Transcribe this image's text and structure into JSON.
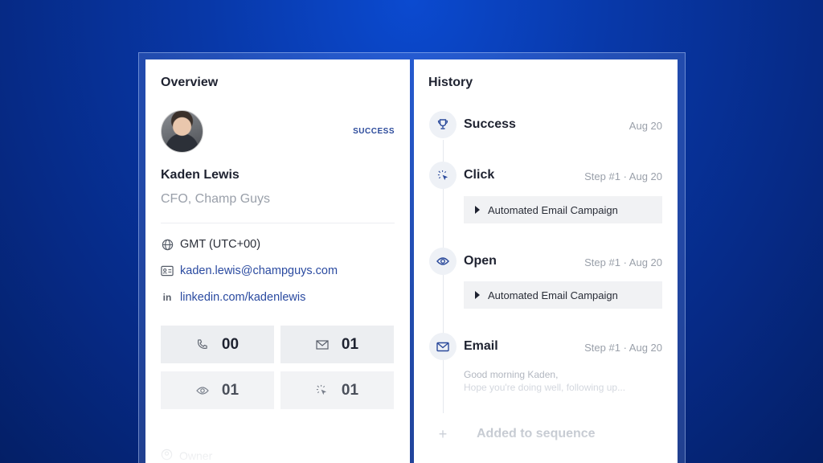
{
  "overview": {
    "title": "Overview",
    "status": "SUCCESS",
    "person": {
      "name": "Kaden Lewis",
      "role": "CFO, Champ Guys"
    },
    "contact": {
      "timezone": "GMT (UTC+00)",
      "email": "kaden.lewis@champguys.com",
      "linkedin": "linkedin.com/kadenlewis"
    },
    "stats": [
      {
        "icon": "phone-icon",
        "value": "00"
      },
      {
        "icon": "mail-open-icon",
        "value": "01"
      },
      {
        "icon": "eye-icon",
        "value": "01"
      },
      {
        "icon": "click-icon",
        "value": "01"
      }
    ],
    "owner_label": "Owner"
  },
  "history": {
    "title": "History",
    "events": [
      {
        "icon": "trophy-icon",
        "title": "Success",
        "meta": "Aug 20"
      },
      {
        "icon": "click-icon",
        "title": "Click",
        "meta": "Step #1 · Aug 20",
        "card": "Automated Email Campaign"
      },
      {
        "icon": "eye-icon",
        "title": "Open",
        "meta": "Step #1 · Aug 20",
        "card": "Automated Email Campaign"
      },
      {
        "icon": "mail-icon",
        "title": "Email",
        "meta": "Step #1 · Aug 20",
        "preview_line1": "Good morning Kaden,",
        "preview_line2": "Hope you're doing well, following up..."
      }
    ],
    "added_label": "Added to sequence"
  },
  "colors": {
    "accent": "#2b4a9b",
    "background": "#0838a8"
  }
}
